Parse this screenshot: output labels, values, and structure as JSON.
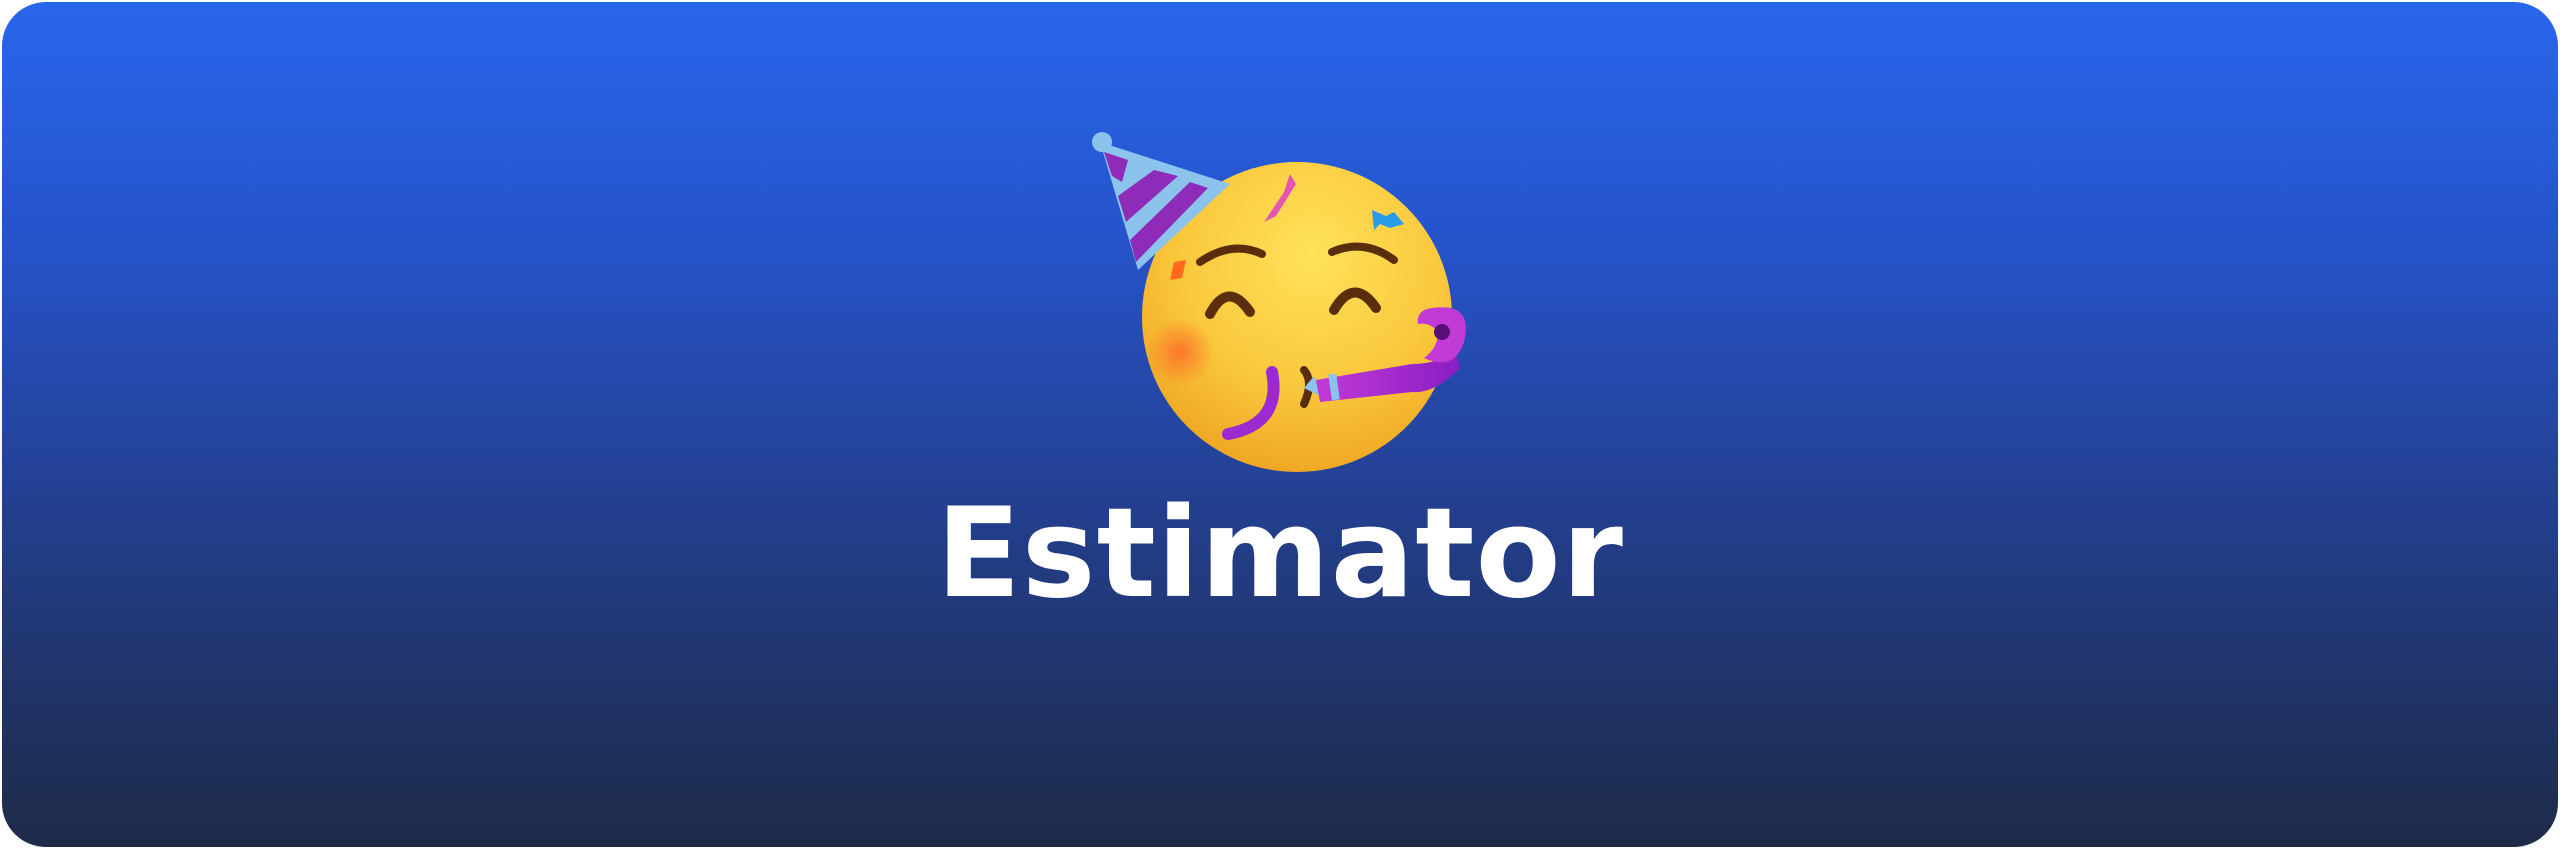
{
  "banner": {
    "title": "Estimator",
    "icon": "partying-face-icon",
    "colors": {
      "gradient_top": "#2866ec",
      "gradient_bottom": "#1e2a48",
      "title_text": "#ffffff",
      "face": "#f9c63a"
    }
  }
}
